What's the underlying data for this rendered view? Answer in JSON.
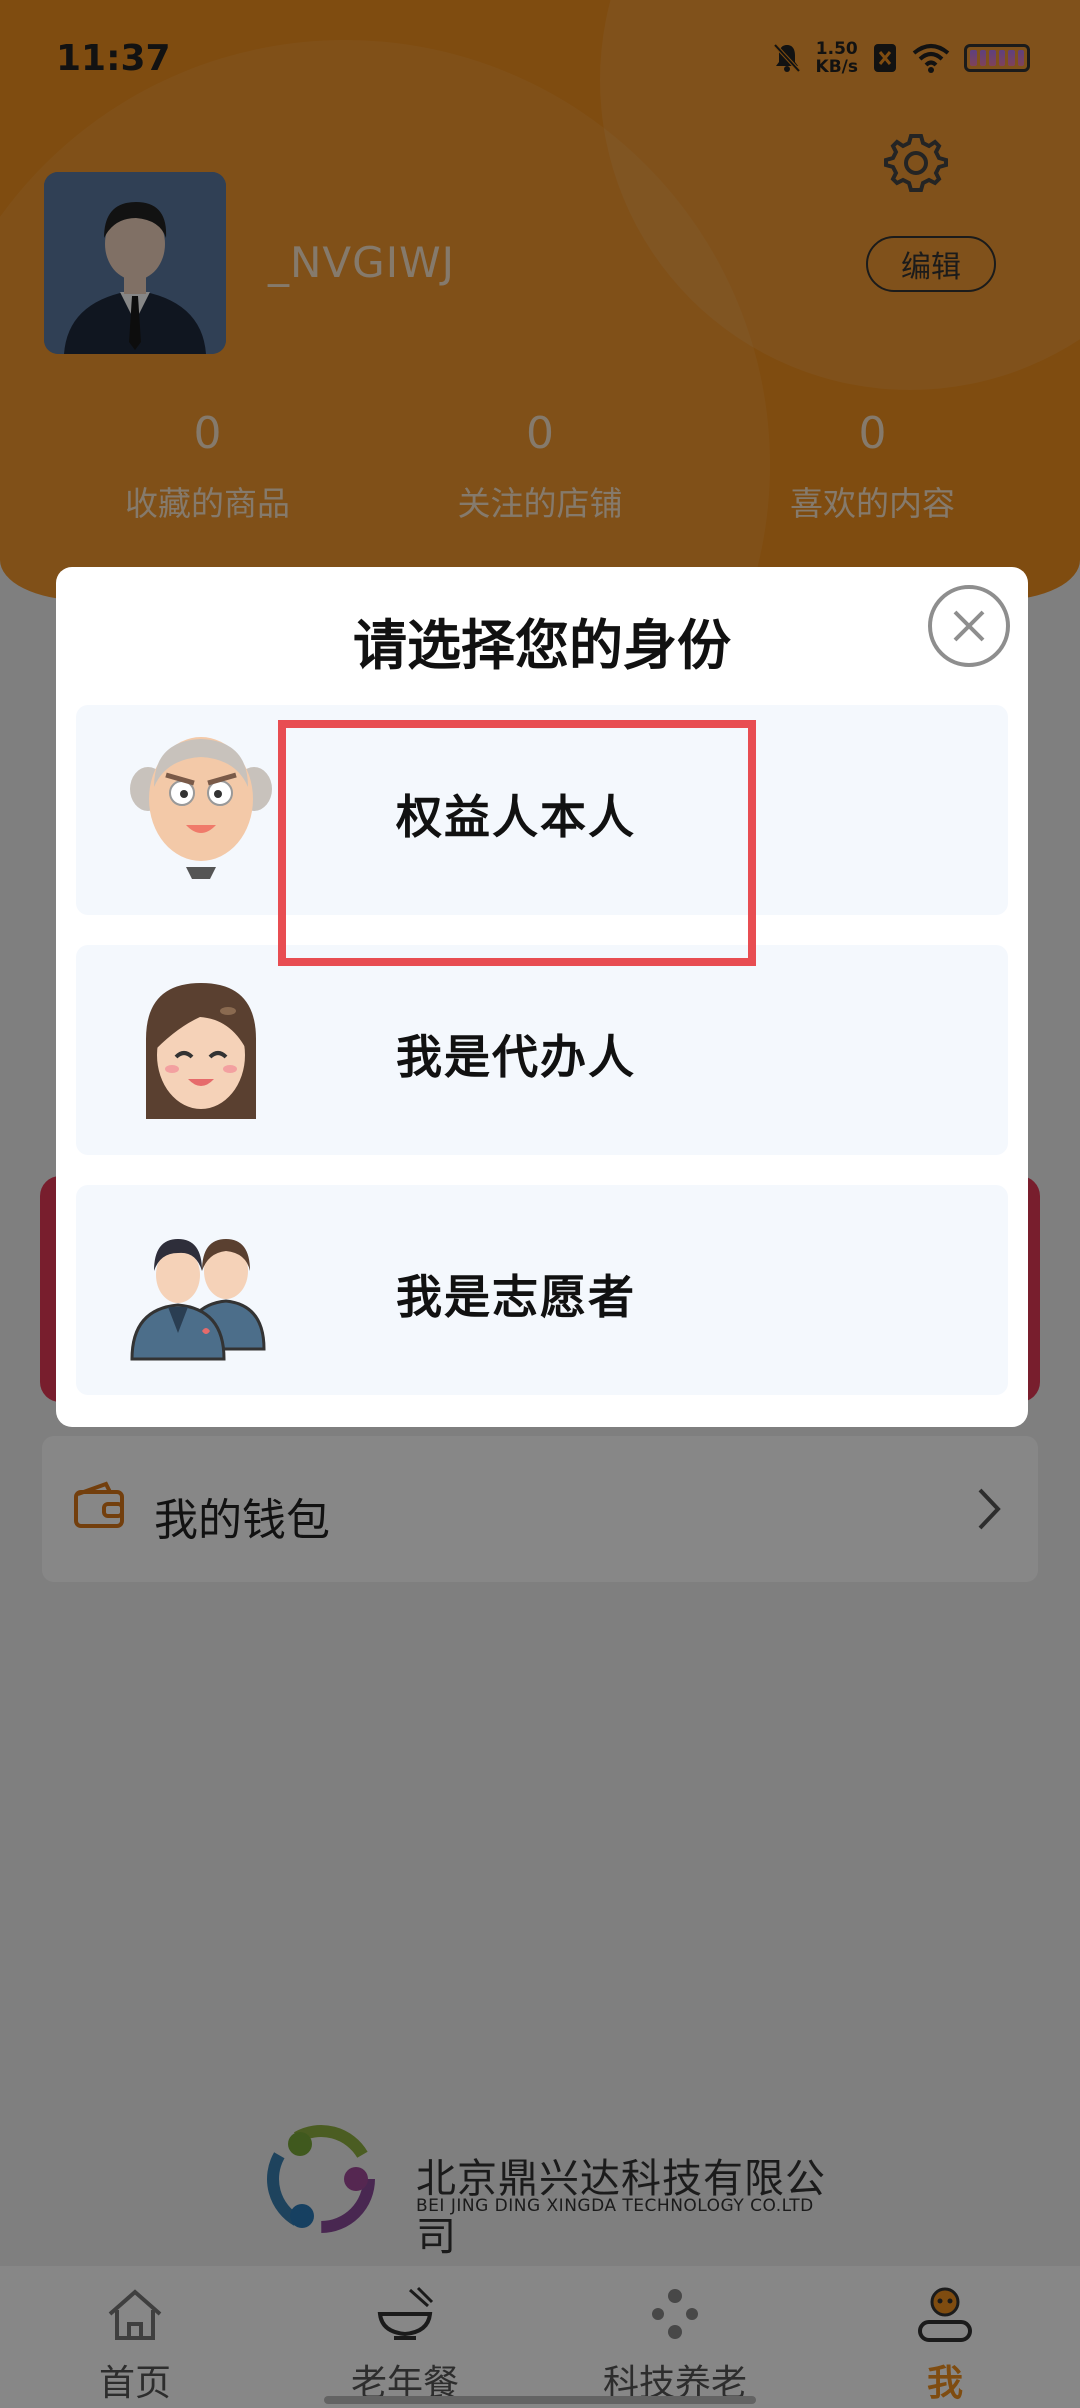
{
  "status_bar": {
    "time": "11:37",
    "speed_value": "1.50",
    "speed_unit": "KB/s"
  },
  "profile": {
    "username": "_NVGIWJ",
    "edit_label": "编辑"
  },
  "stats": [
    {
      "count": "0",
      "label": "收藏的商品"
    },
    {
      "count": "0",
      "label": "关注的店铺"
    },
    {
      "count": "0",
      "label": "喜欢的内容"
    }
  ],
  "wallet": {
    "label": "我的钱包"
  },
  "company": {
    "name_cn": "北京鼎兴达科技有限公司",
    "name_en": "BEI JING DING XINGDA TECHNOLOGY CO.LTD"
  },
  "dialog": {
    "title": "请选择您的身份",
    "options": [
      {
        "label": "权益人本人",
        "icon": "elderly-man-icon"
      },
      {
        "label": "我是代办人",
        "icon": "woman-icon"
      },
      {
        "label": "我是志愿者",
        "icon": "volunteers-icon"
      }
    ]
  },
  "tabbar": {
    "items": [
      {
        "label": "首页",
        "icon": "home-icon",
        "active": false
      },
      {
        "label": "老年餐",
        "icon": "bowl-icon",
        "active": false
      },
      {
        "label": "科技养老",
        "icon": "dots-icon",
        "active": false
      },
      {
        "label": "我",
        "icon": "profile-icon",
        "active": true
      }
    ]
  },
  "colors": {
    "brand_orange": "#f0901f",
    "highlight_red": "#e84d52",
    "card_red": "#e23a55"
  }
}
